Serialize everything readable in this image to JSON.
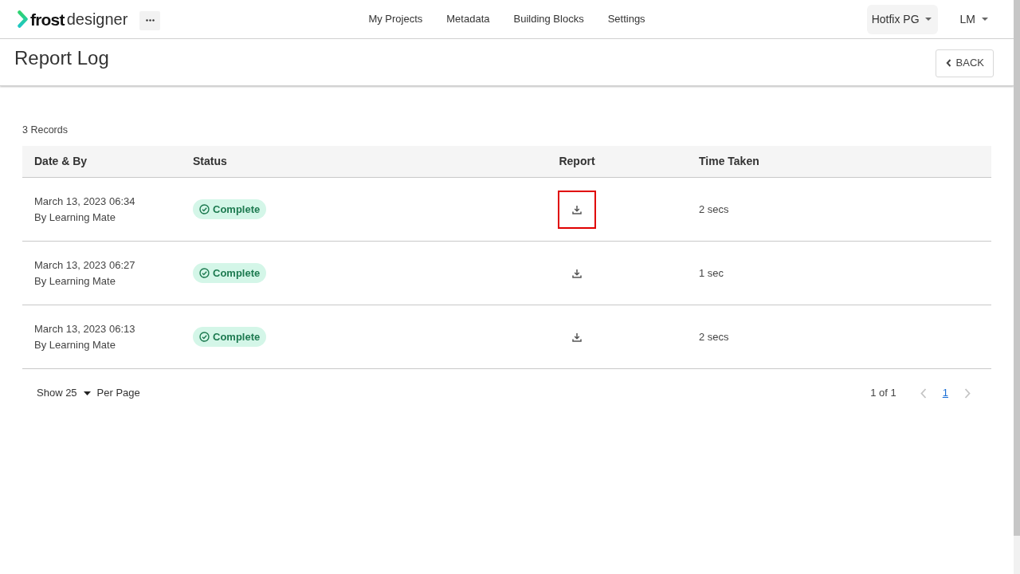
{
  "app_bar": {
    "logo": {
      "brand": "frost",
      "product": "designer"
    },
    "nav": [
      {
        "label": "My Projects",
        "selected": false
      },
      {
        "label": "Metadata",
        "selected": false
      },
      {
        "label": "Building Blocks",
        "selected": false
      },
      {
        "label": "Settings",
        "selected": false
      }
    ],
    "workspace_menu": "Hotfix PG",
    "user_menu": "LM"
  },
  "page_header": {
    "title": "Report Log",
    "back_button": "BACK"
  },
  "records_count": "3 Records",
  "table": {
    "columns": [
      "Date & By",
      "Status",
      "Report",
      "Time Taken"
    ],
    "rows": [
      {
        "date": "March 13, 2023 06:34",
        "by": "By Learning Mate",
        "status": {
          "label": "Complete",
          "kind": "complete"
        },
        "report_highlighted": true,
        "time_taken": "2 secs"
      },
      {
        "date": "March 13, 2023 06:27",
        "by": "By Learning Mate",
        "status": {
          "label": "Complete",
          "kind": "complete"
        },
        "report_highlighted": false,
        "time_taken": "1 sec"
      },
      {
        "date": "March 13, 2023 06:13",
        "by": "By Learning Mate",
        "status": {
          "label": "Complete",
          "kind": "complete"
        },
        "report_highlighted": false,
        "time_taken": "2 secs"
      }
    ]
  },
  "footer": {
    "page_size_button": "Show 25",
    "page_size_suffix": "Per Page",
    "pagination": {
      "summary": "1 of 1",
      "previous_disabled": true,
      "pages": [
        {
          "label": "1",
          "selected": true
        }
      ],
      "next_disabled": true
    }
  }
}
